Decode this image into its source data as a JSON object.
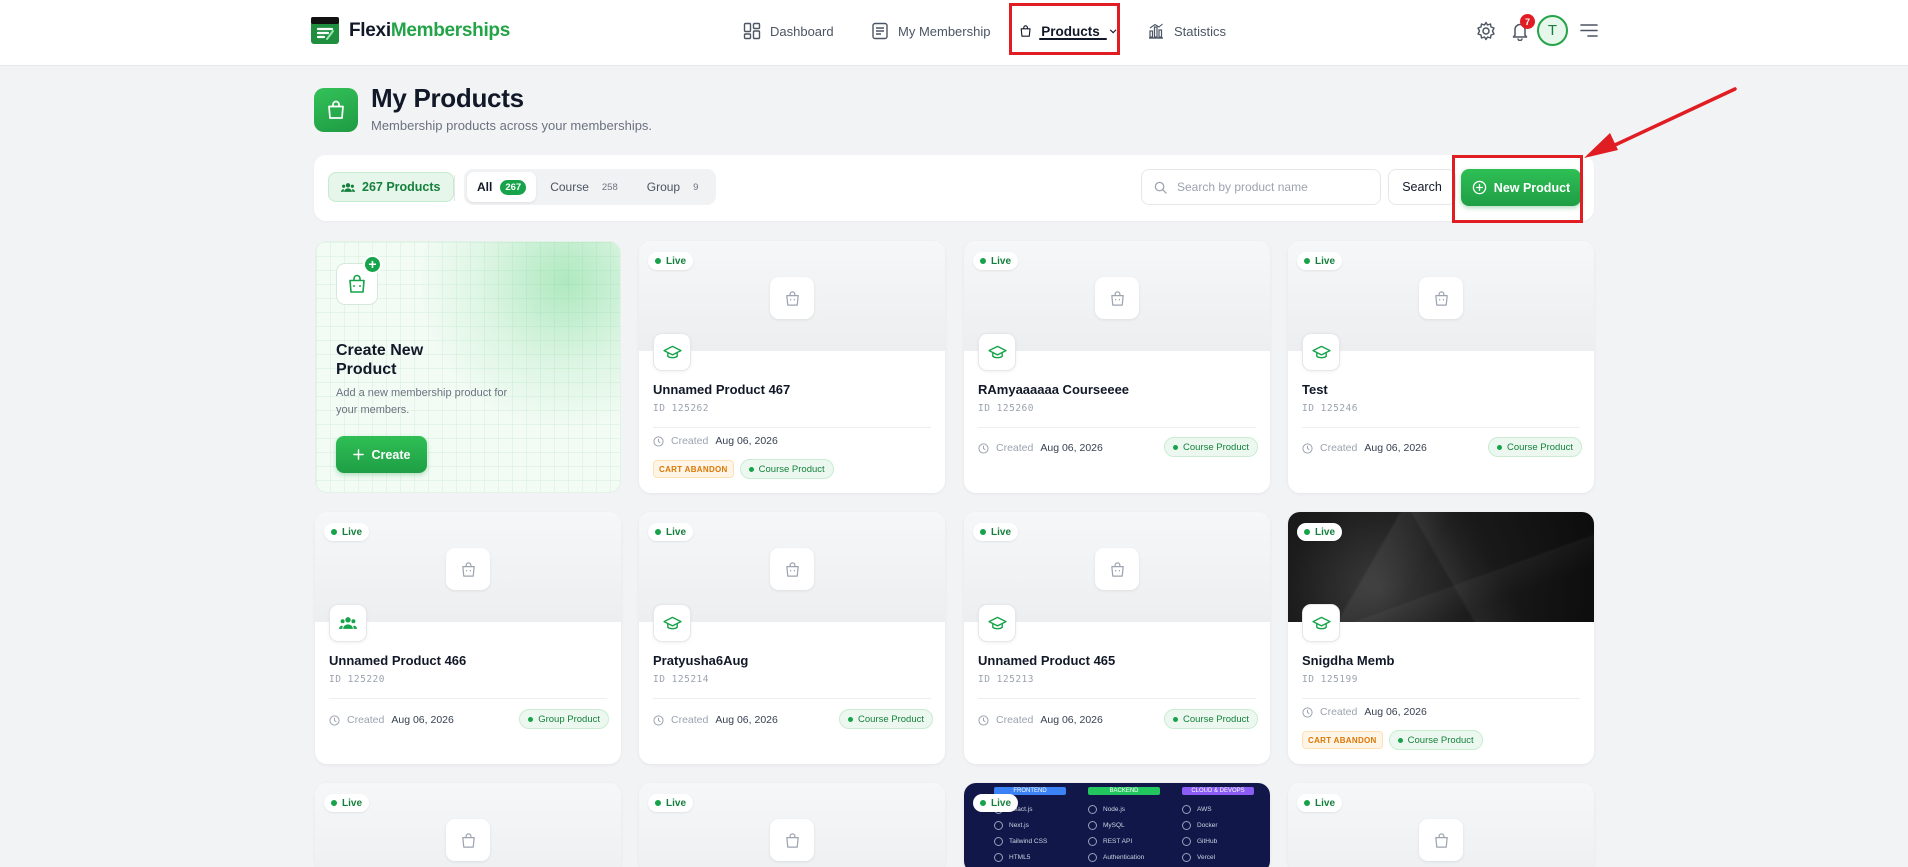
{
  "app": {
    "logo_part1": "Flexi",
    "logo_part2": "Memberships",
    "accent_color": "#22a447",
    "highlight_color": "#e11d24"
  },
  "nav": {
    "dashboard": "Dashboard",
    "my_membership": "My Membership",
    "products": "Products",
    "statistics": "Statistics"
  },
  "header": {
    "notification_count": "7",
    "avatar_initial": "T"
  },
  "page": {
    "title": "My Products",
    "subtitle": "Membership products across your memberships."
  },
  "filters": {
    "product_count": "267 Products",
    "tabs": [
      {
        "label": "All",
        "count": "267"
      },
      {
        "label": "Course",
        "count": "258"
      },
      {
        "label": "Group",
        "count": "9"
      }
    ],
    "search_placeholder": "Search by product name",
    "search_value": "",
    "search_button": "Search",
    "new_product_button": "New Product"
  },
  "create_card": {
    "title": "Create New Product",
    "description": "Add a new membership product for your members.",
    "button": "Create"
  },
  "labels": {
    "live": "Live",
    "created": "Created",
    "cart_abandon": "CART ABANDON"
  },
  "products": [
    {
      "name": "Unnamed Product 467",
      "id": "ID 125262",
      "date": "Aug 06, 2026",
      "type": "Course Product",
      "cart_abandon": true,
      "icon": "graduation-cap-icon"
    },
    {
      "name": "RAmyaaaaaa Courseeee",
      "id": "ID 125260",
      "date": "Aug 06, 2026",
      "type": "Course Product",
      "cart_abandon": false,
      "icon": "graduation-cap-icon"
    },
    {
      "name": "Test",
      "id": "ID 125246",
      "date": "Aug 06, 2026",
      "type": "Course Product",
      "cart_abandon": false,
      "icon": "graduation-cap-icon"
    },
    {
      "name": "Unnamed Product 466",
      "id": "ID 125220",
      "date": "Aug 06, 2026",
      "type": "Group Product",
      "cart_abandon": false,
      "icon": "users-icon"
    },
    {
      "name": "Pratyusha6Aug",
      "id": "ID 125214",
      "date": "Aug 06, 2026",
      "type": "Course Product",
      "cart_abandon": false,
      "icon": "graduation-cap-icon"
    },
    {
      "name": "Unnamed Product 465",
      "id": "ID 125213",
      "date": "Aug 06, 2026",
      "type": "Course Product",
      "cart_abandon": false,
      "icon": "graduation-cap-icon"
    },
    {
      "name": "Snigdha Memb",
      "id": "ID 125199",
      "date": "Aug 06, 2026",
      "type": "Course Product",
      "cart_abandon": true,
      "icon": "graduation-cap-icon"
    }
  ],
  "tech_banner": {
    "columns": [
      {
        "head": "FRONTEND",
        "color": "#3b82f6",
        "items": [
          "React.js",
          "Next.js",
          "Tailwind CSS",
          "HTML5"
        ]
      },
      {
        "head": "BACKEND",
        "color": "#22c55e",
        "items": [
          "Node.js",
          "MySQL",
          "REST API",
          "Authentication"
        ]
      },
      {
        "head": "CLOUD & DEVOPS",
        "color": "#8b5cf6",
        "items": [
          "AWS",
          "Docker",
          "GitHub",
          "Vercel"
        ]
      }
    ]
  }
}
